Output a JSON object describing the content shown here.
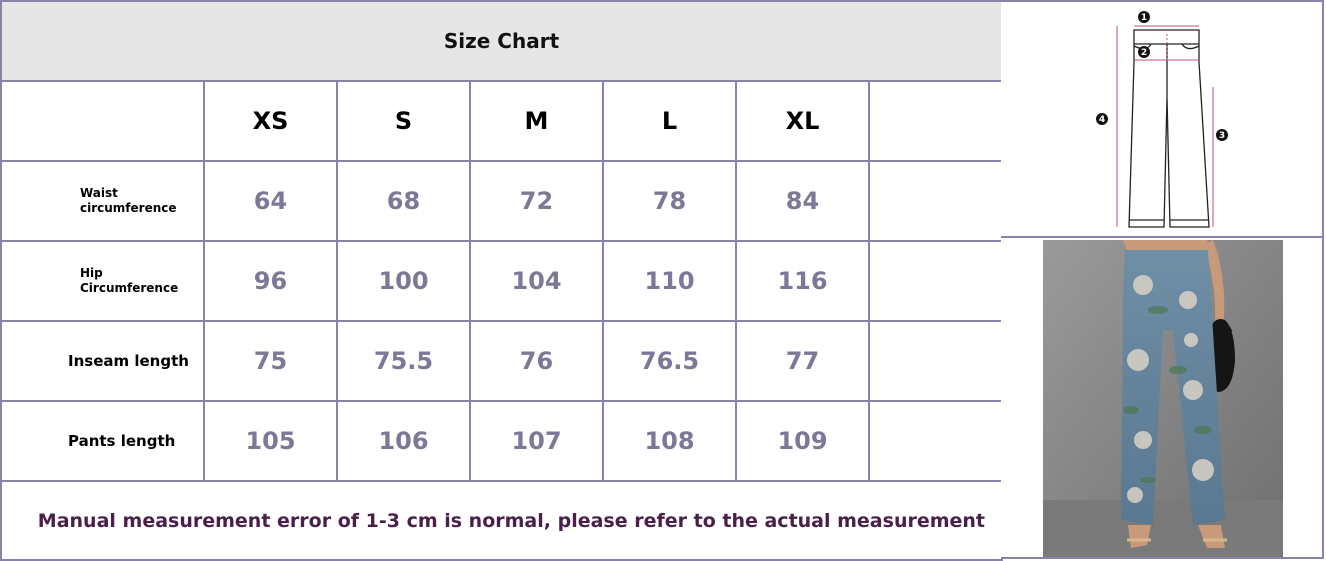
{
  "chart": {
    "title": "Size Chart",
    "sizes": [
      "XS",
      "S",
      "M",
      "L",
      "XL"
    ],
    "rows": [
      {
        "label": "Waist\ncircumference",
        "values": [
          "64",
          "68",
          "72",
          "78",
          "84"
        ]
      },
      {
        "label": "Hip\nCircumference",
        "values": [
          "96",
          "100",
          "104",
          "110",
          "116"
        ]
      },
      {
        "label": "Inseam length",
        "values": [
          "75",
          "75.5",
          "76",
          "76.5",
          "77"
        ]
      },
      {
        "label": "Pants length",
        "values": [
          "105",
          "106",
          "107",
          "108",
          "109"
        ]
      }
    ],
    "note": "Manual measurement error of 1-3 cm is normal, please refer to the actual measurement"
  },
  "diagram": {
    "markers": [
      "1",
      "2",
      "3",
      "4"
    ],
    "icon": "pants-measurement-diagram"
  },
  "photo": {
    "icon": "floral-jeans-model-photo"
  },
  "colors": {
    "border": "#8a82a8",
    "title_bg": "#e6e6e6",
    "value_text": "#7d7898",
    "note_text": "#4a1f4a",
    "measure_line": "#c0506a"
  }
}
